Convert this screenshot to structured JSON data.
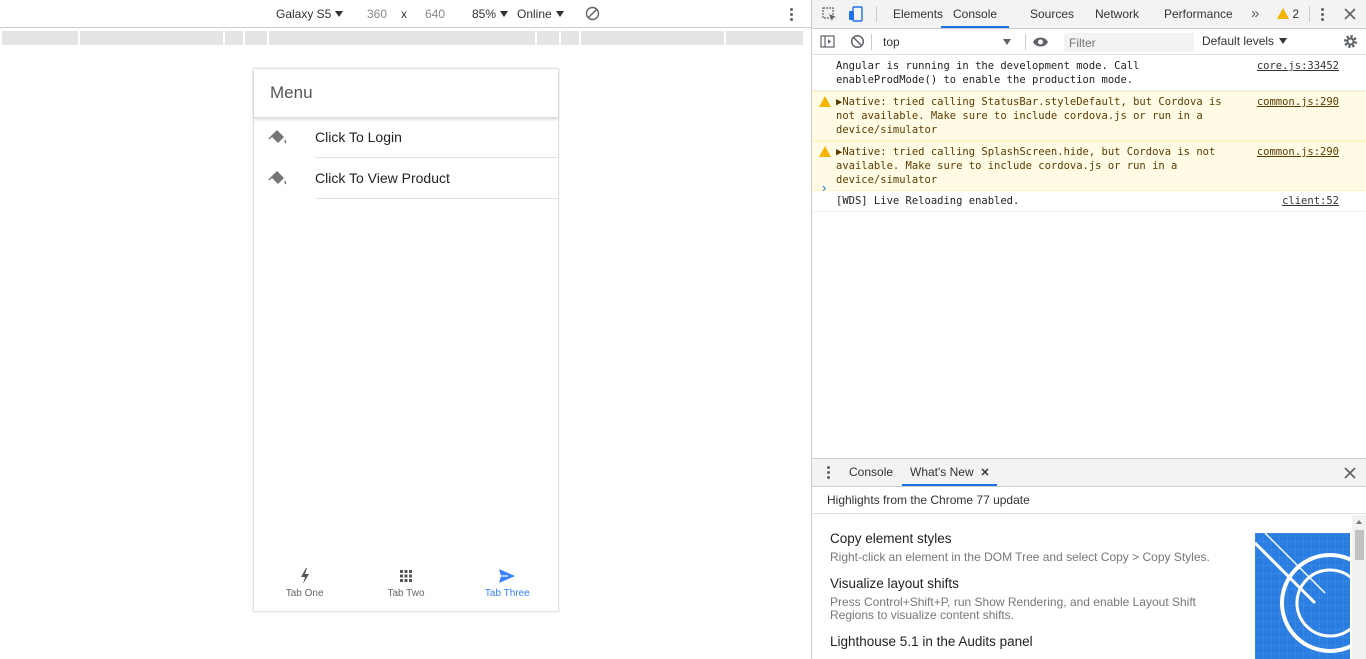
{
  "device_toolbar": {
    "device": "Galaxy S5",
    "width": "360",
    "times": "x",
    "height": "640",
    "zoom": "85%",
    "network": "Online"
  },
  "app": {
    "header_title": "Menu",
    "menu_items": [
      {
        "label": "Click To Login",
        "icon": "paint-bucket-icon"
      },
      {
        "label": "Click To View Product",
        "icon": "paint-bucket-icon"
      }
    ],
    "tabs": [
      {
        "label": "Tab One",
        "icon": "flash-icon",
        "active": false
      },
      {
        "label": "Tab Two",
        "icon": "apps-icon",
        "active": false
      },
      {
        "label": "Tab Three",
        "icon": "send-icon",
        "active": true
      }
    ],
    "accent_color": "#3880ff"
  },
  "devtools": {
    "tabs": [
      "Elements",
      "Console",
      "Sources",
      "Network",
      "Performance"
    ],
    "active_tab": "Console",
    "more": "»",
    "warning_count": "2",
    "context": "top",
    "filter_placeholder": "Filter",
    "levels": "Default levels",
    "messages": [
      {
        "type": "info",
        "text": "Angular is running in the development mode. Call enableProdMode() to enable the production mode.",
        "source": "core.js:33452"
      },
      {
        "type": "warning",
        "text": "▶Native: tried calling StatusBar.styleDefault, but Cordova is not available. Make sure to include cordova.js or run in a device/simulator",
        "source": "common.js:290"
      },
      {
        "type": "warning",
        "text": "▶Native: tried calling SplashScreen.hide, but Cordova is not available. Make sure to include cordova.js or run in a device/simulator",
        "source": "common.js:290"
      },
      {
        "type": "info",
        "text": "[WDS] Live Reloading enabled.",
        "source": "client:52"
      }
    ],
    "prompt": "›",
    "drawer": {
      "tabs": [
        "Console",
        "What's New"
      ],
      "active_tab": "What's New",
      "highlights": "Highlights from the Chrome 77 update",
      "items": [
        {
          "title": "Copy element styles",
          "desc": "Right-click an element in the DOM Tree and select Copy > Copy Styles."
        },
        {
          "title": "Visualize layout shifts",
          "desc": "Press Control+Shift+P, run Show Rendering, and enable Layout Shift Regions to visualize content shifts."
        },
        {
          "title": "Lighthouse 5.1 in the Audits panel",
          "desc": ""
        }
      ]
    }
  }
}
